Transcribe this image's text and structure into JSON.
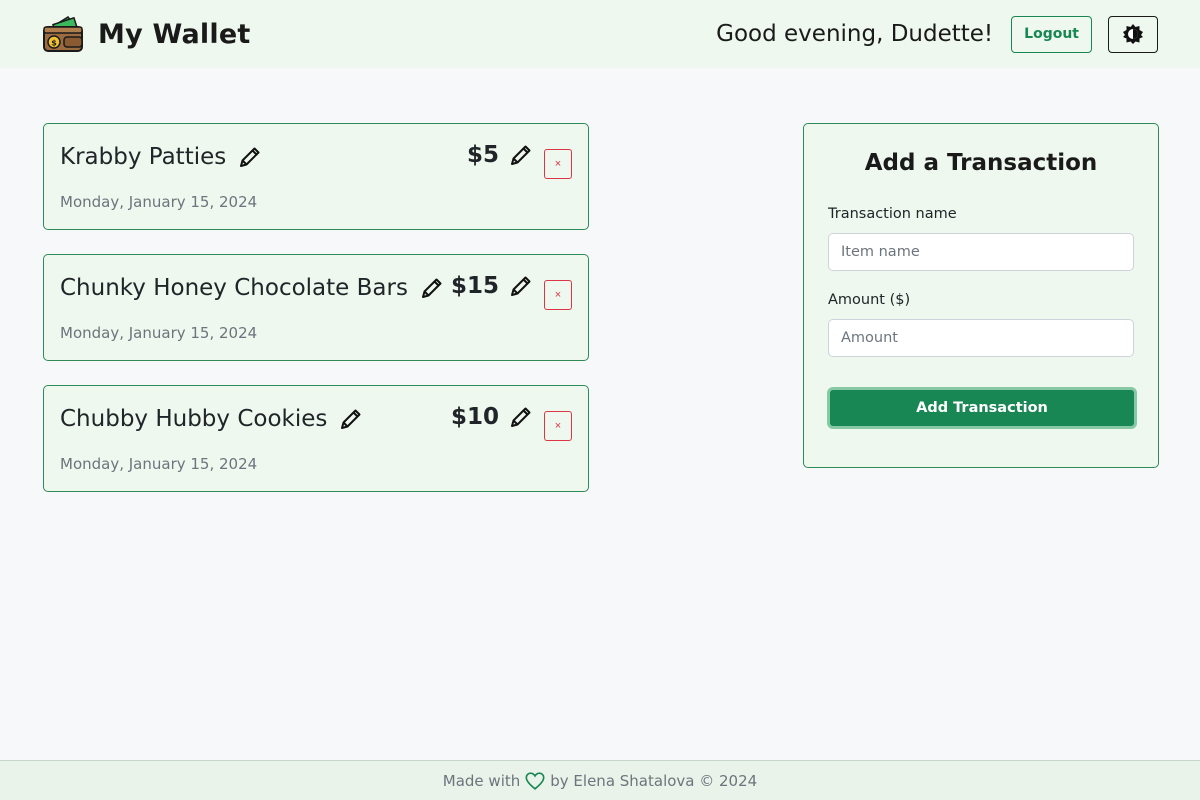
{
  "header": {
    "title": "My Wallet",
    "greeting": "Good evening, Dudette!",
    "logout_label": "Logout",
    "logo_icon": "wallet-icon",
    "theme_icon": "contrast-icon"
  },
  "transactions": [
    {
      "name": "Krabby Patties",
      "amount": "$5",
      "date": "Monday, January 15, 2024",
      "delete_label": "×"
    },
    {
      "name": "Chunky Honey Chocolate Bars",
      "amount": "$15",
      "date": "Monday, January 15, 2024",
      "delete_label": "×"
    },
    {
      "name": "Chubby Hubby Cookies",
      "amount": "$10",
      "date": "Monday, January 15, 2024",
      "delete_label": "×"
    }
  ],
  "form": {
    "title": "Add a Transaction",
    "name_label": "Transaction name",
    "name_placeholder": "Item name",
    "amount_label": "Amount ($)",
    "amount_placeholder": "Amount",
    "submit_label": "Add Transaction"
  },
  "footer": {
    "prefix": "Made with",
    "suffix": "by Elena Shatalova © 2024"
  },
  "colors": {
    "accent": "#198754",
    "danger": "#dc3545",
    "panel_bg": "#eef8ee"
  }
}
